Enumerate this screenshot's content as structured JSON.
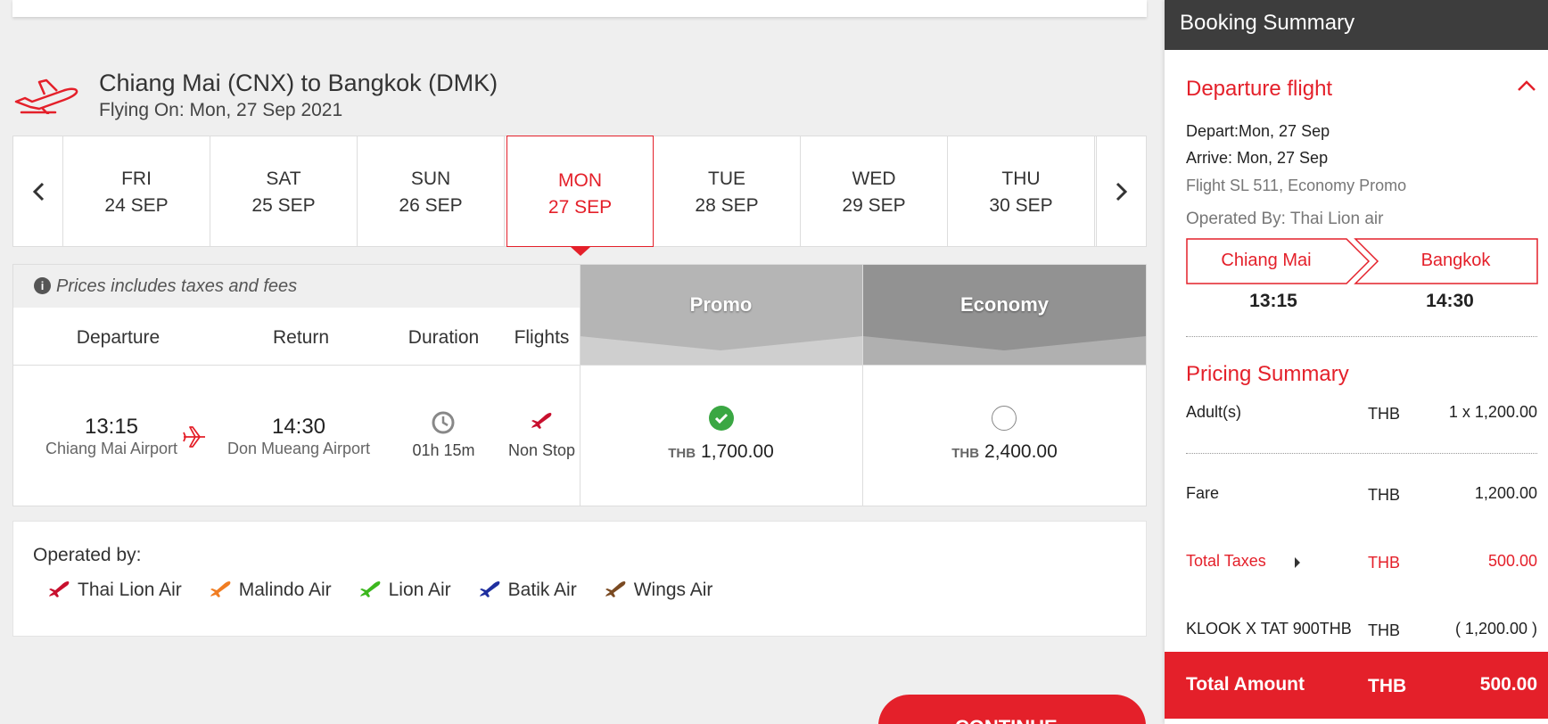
{
  "route": {
    "title": "Chiang Mai (CNX) to Bangkok (DMK)",
    "flying_on": "Flying On: Mon, 27 Sep 2021"
  },
  "dates": [
    {
      "day": "FRI",
      "date": "24 SEP"
    },
    {
      "day": "SAT",
      "date": "25 SEP"
    },
    {
      "day": "SUN",
      "date": "26 SEP"
    },
    {
      "day": "MON",
      "date": "27 SEP"
    },
    {
      "day": "TUE",
      "date": "28 SEP"
    },
    {
      "day": "WED",
      "date": "29 SEP"
    },
    {
      "day": "THU",
      "date": "30 SEP"
    }
  ],
  "table": {
    "tax_note": "Prices includes taxes and fees",
    "headers": {
      "departure": "Departure",
      "return": "Return",
      "duration": "Duration",
      "flights": "Flights"
    },
    "fare_classes": {
      "promo": "Promo",
      "economy": "Economy"
    },
    "row": {
      "depart_time": "13:15",
      "depart_airport": "Chiang Mai Airport",
      "arrive_time": "14:30",
      "arrive_airport": "Don Mueang Airport",
      "duration": "01h 15m",
      "stops": "Non Stop",
      "promo_currency": "THB",
      "promo_price": "1,700.00",
      "economy_currency": "THB",
      "economy_price": "2,400.00"
    }
  },
  "operated": {
    "title": "Operated by:",
    "airlines": [
      {
        "name": "Thai Lion Air",
        "color": "#c8102e"
      },
      {
        "name": "Malindo Air",
        "color": "#f07d22"
      },
      {
        "name": "Lion Air",
        "color": "#3cb71e"
      },
      {
        "name": "Batik Air",
        "color": "#1f2f9f"
      },
      {
        "name": "Wings Air",
        "color": "#7a4a22"
      }
    ]
  },
  "continue_label": "CONTINUE",
  "summary": {
    "header": "Booking Summary",
    "departure_title": "Departure flight",
    "depart": "Depart:Mon, 27 Sep",
    "arrive": "Arrive: Mon, 27 Sep",
    "flight": "Flight SL 511, Economy Promo",
    "operated_by": "Operated By: Thai Lion air",
    "from_city": "Chiang Mai",
    "to_city": "Bangkok",
    "from_time": "13:15",
    "to_time": "14:30",
    "pricing_title": "Pricing Summary",
    "rows": {
      "adults": {
        "label": "Adult(s)",
        "currency": "THB",
        "amount": "1 x 1,200.00"
      },
      "fare": {
        "label": "Fare",
        "currency": "THB",
        "amount": "1,200.00"
      },
      "taxes": {
        "label": "Total Taxes",
        "currency": "THB",
        "amount": "500.00"
      },
      "discount": {
        "label": "KLOOK X TAT 900THB",
        "currency": "THB",
        "amount": "( 1,200.00 )"
      }
    },
    "total": {
      "label": "Total Amount",
      "currency": "THB",
      "amount": "500.00"
    }
  },
  "colors": {
    "accent": "#e4202a",
    "promo_header": "#b5b5b5",
    "economy_header": "#929292",
    "check_green": "#3aa743"
  }
}
